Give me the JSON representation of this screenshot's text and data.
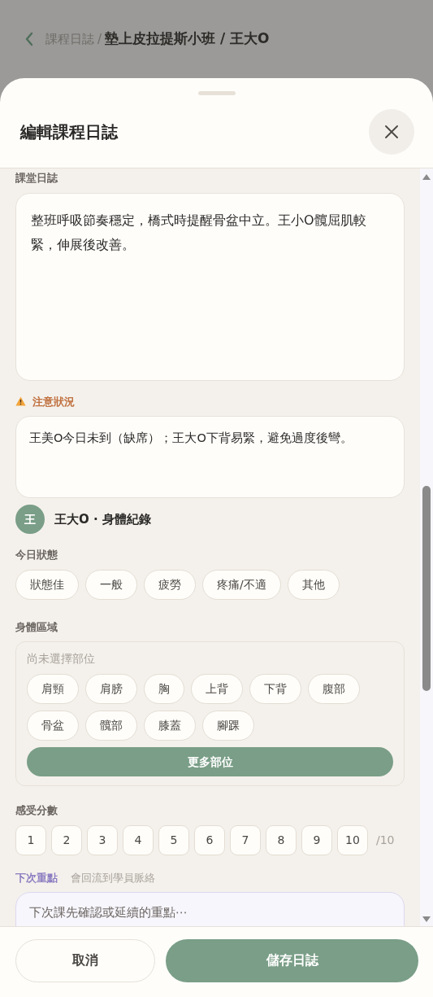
{
  "background_header": {
    "breadcrumb_parent": "課程日誌",
    "separator": "/",
    "breadcrumb_current": "墊上皮拉提斯小班 / 王大O"
  },
  "sheet": {
    "title": "編輯課程日誌"
  },
  "class_log": {
    "label": "課堂日誌",
    "value": "整班呼吸節奏穩定，橋式時提醒骨盆中立。王小O髖屈肌較緊，伸展後改善。"
  },
  "attention": {
    "label": "注意狀況",
    "value": "王美O今日未到（缺席）；王大O下背易緊，避免過度後彎。"
  },
  "student": {
    "avatar": "王",
    "title": "王大O · 身體紀錄"
  },
  "today_status": {
    "label": "今日狀態",
    "options": [
      {
        "label": "狀態佳",
        "selected": false
      },
      {
        "label": "一般",
        "selected": false
      },
      {
        "label": "疲勞",
        "selected": false
      },
      {
        "label": "疼痛/不適",
        "selected": false
      },
      {
        "label": "其他",
        "selected": false
      }
    ]
  },
  "body_area": {
    "label": "身體區域",
    "hint": "尚未選擇部位",
    "options": [
      {
        "label": "肩頸",
        "selected": false
      },
      {
        "label": "肩膀",
        "selected": false
      },
      {
        "label": "胸",
        "selected": false
      },
      {
        "label": "上背",
        "selected": false
      },
      {
        "label": "下背",
        "selected": false
      },
      {
        "label": "腹部",
        "selected": false
      },
      {
        "label": "骨盆",
        "selected": false
      },
      {
        "label": "髖部",
        "selected": false
      },
      {
        "label": "膝蓋",
        "selected": false
      },
      {
        "label": "腳踝",
        "selected": false
      }
    ],
    "more_button": "更多部位"
  },
  "feeling_score": {
    "label": "感受分數",
    "options": [
      {
        "label": "1",
        "selected": false
      },
      {
        "label": "2",
        "selected": false
      },
      {
        "label": "3",
        "selected": false
      },
      {
        "label": "4",
        "selected": false
      },
      {
        "label": "5",
        "selected": false
      },
      {
        "label": "6",
        "selected": false
      },
      {
        "label": "7",
        "selected": false
      },
      {
        "label": "8",
        "selected": false
      },
      {
        "label": "9",
        "selected": false
      },
      {
        "label": "10",
        "selected": false
      }
    ],
    "suffix": "/10"
  },
  "next_focus": {
    "label": "下次重點",
    "note": "會回流到學員脈絡",
    "placeholder": "下次課先確認或延續的重點⋯"
  },
  "footer": {
    "cancel": "取消",
    "save": "儲存日誌"
  }
}
